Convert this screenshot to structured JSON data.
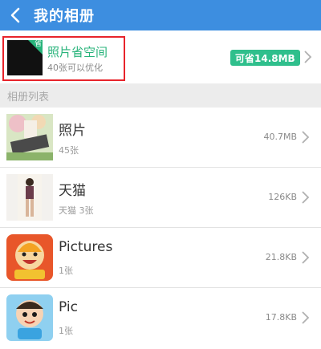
{
  "header": {
    "title": "我的相册",
    "back_icon": "back-chevron-icon"
  },
  "space": {
    "title": "照片省空间",
    "subtitle": "40张可以优化",
    "badge": "可省14.8MB",
    "corner_label": "省",
    "accent": "#27b37a"
  },
  "section": {
    "label": "相册列表"
  },
  "albums": [
    {
      "name": "照片",
      "count": "45张",
      "size": "40.7MB"
    },
    {
      "name": "天猫",
      "count": "天猫  3张",
      "size": "126KB"
    },
    {
      "name": "Pictures",
      "count": "1张",
      "size": "21.8KB"
    },
    {
      "name": "Pic",
      "count": "1张",
      "size": "17.8KB"
    }
  ],
  "colors": {
    "header": "#3d8ee0",
    "highlight": "#e8242b",
    "badge": "#2fbf8c"
  }
}
